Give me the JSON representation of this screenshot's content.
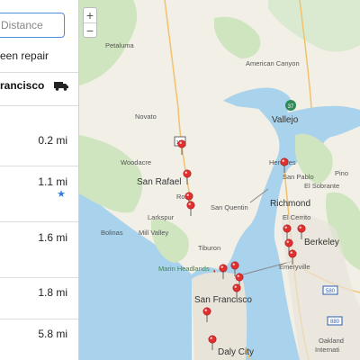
{
  "sidebar": {
    "search_placeholder": "Distance",
    "filter_label": "een repair",
    "location_label": "rancisco",
    "results": [
      {
        "distance": "0.2 mi",
        "starred": false
      },
      {
        "distance": "1.1 mi",
        "starred": true
      },
      {
        "distance": "1.6 mi",
        "starred": false
      },
      {
        "distance": "1.8 mi",
        "starred": false
      },
      {
        "distance": "5.8 mi",
        "starred": false
      }
    ],
    "star_glyph": "★"
  },
  "map": {
    "zoom_in": "+",
    "zoom_out": "−",
    "route_37": "37",
    "route_580": "580",
    "route_880": "880",
    "route_101": "101",
    "labels": {
      "petaluma": "Petaluma",
      "american_canyon": "American Canyon",
      "novato": "Novato",
      "vallejo": "Vallejo",
      "woodacre": "Woodacre",
      "hercules": "Hercules",
      "san_rafael": "San Rafael",
      "san_pablo": "San Pablo",
      "ross": "Ross",
      "el_sobrante": "El Sobrante",
      "pinole": "Pino",
      "san_quentin": "San Quentin",
      "richmond": "Richmond",
      "larkspur": "Larkspur",
      "el_cerrito": "El Cerrito",
      "bolinas": "Bolinas",
      "mill_valley": "Mill Valley",
      "berkeley": "Berkeley",
      "tiburon": "Tiburon",
      "marin_headlands": "Marin Headlands",
      "emeryville": "Emeryville",
      "san_francisco": "San Francisco",
      "oakland_airport_1": "Oakland",
      "oakland_airport_2": "Internati",
      "daly_city": "Daly City"
    },
    "colors": {
      "water": "#a9d2ec",
      "land": "#f2efe6",
      "park": "#cfe5c0",
      "pin": "#e03030"
    }
  }
}
